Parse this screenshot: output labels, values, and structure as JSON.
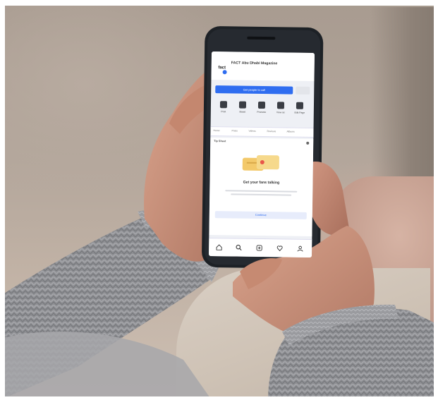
{
  "phone_screen": {
    "page_name": "FACT Abu Dhabi Magazine",
    "cta_label": "Get people to call",
    "actions": [
      {
        "label": "Post",
        "icon": "pencil-square-icon"
      },
      {
        "label": "Boost",
        "icon": "document-icon"
      },
      {
        "label": "Promote",
        "icon": "megaphone-icon"
      },
      {
        "label": "View as",
        "icon": "eye-icon"
      },
      {
        "label": "Edit Page",
        "icon": "pen-icon"
      }
    ],
    "tabs": [
      "Home",
      "Posts",
      "Videos",
      "Reviews",
      "Albums"
    ],
    "card_title": "Tip Sheet",
    "card_heading": "Get your fans talking",
    "card_button": "Continue",
    "nav_icons": [
      "home-icon",
      "search-icon",
      "add-icon",
      "heart-icon",
      "profile-icon"
    ]
  },
  "colors": {
    "accent_blue": "#2f6df0",
    "sweater_gray": "#8d8e91",
    "skin": "#c9917c",
    "phone_body": "#1d2126"
  }
}
